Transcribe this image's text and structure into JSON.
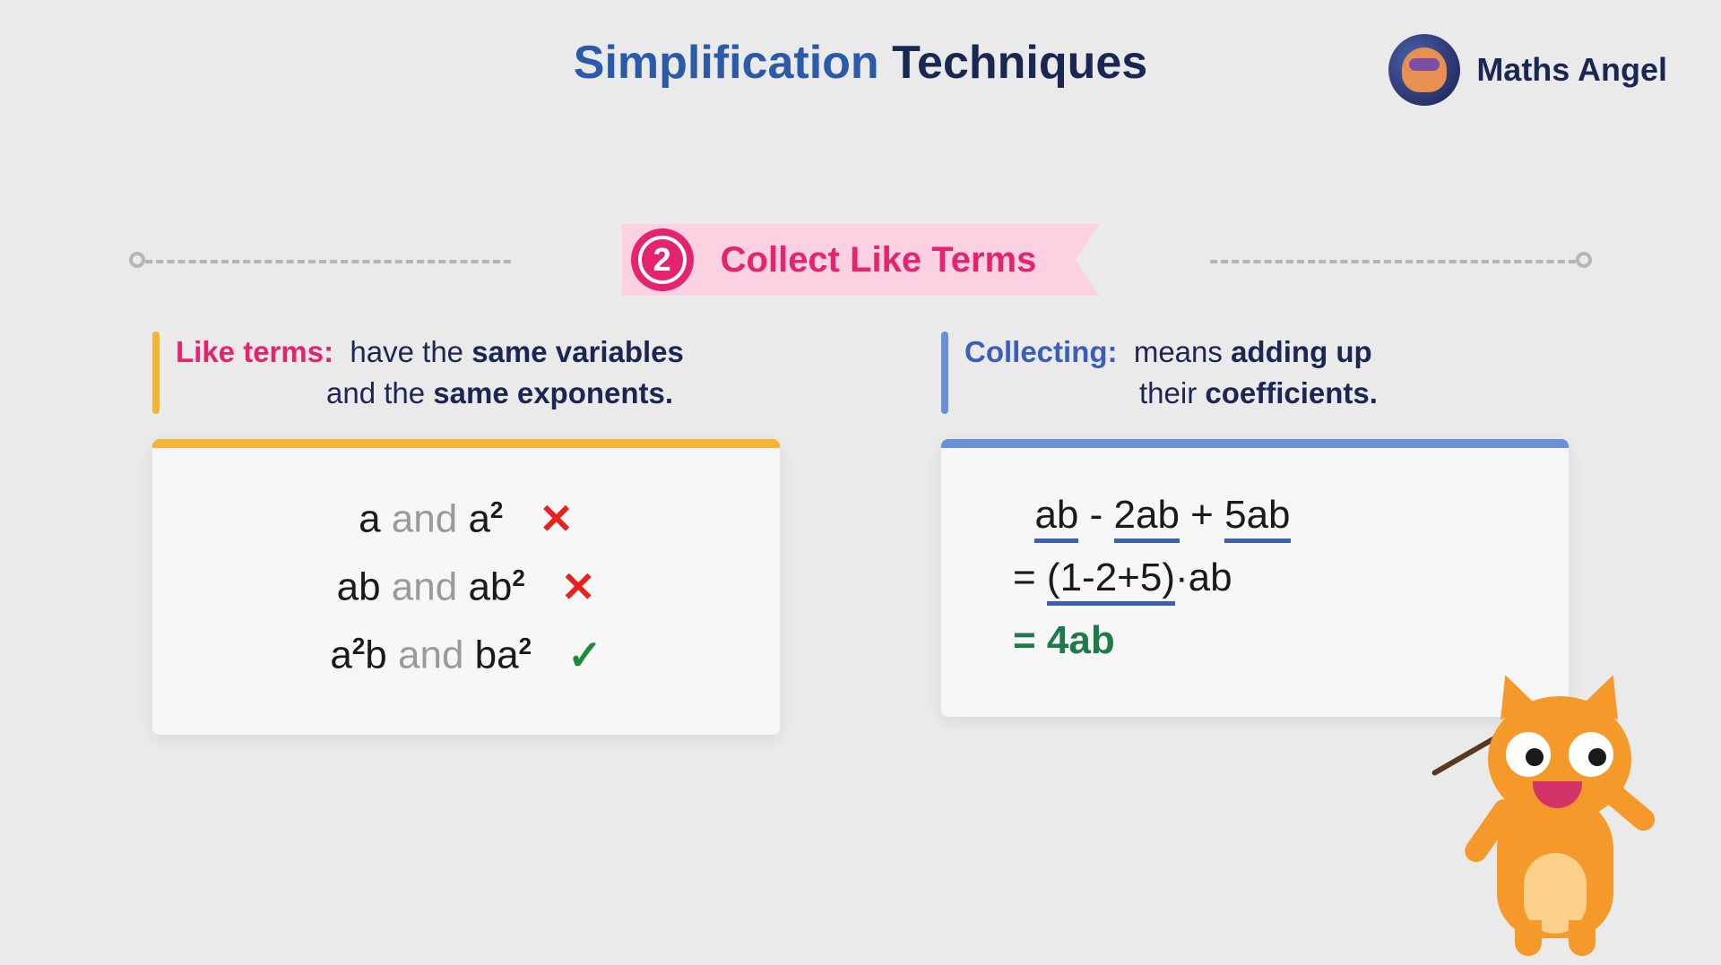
{
  "title": {
    "part1": "Simplification",
    "part2": "Techniques"
  },
  "brand": "Maths Angel",
  "step": {
    "number": "2",
    "label": "Collect Like Terms"
  },
  "left": {
    "label": "Like terms:",
    "text1": "have the",
    "bold1": "same variables",
    "text2": "and the",
    "bold2": "same exponents.",
    "examples": [
      {
        "t1": "a",
        "and": "and",
        "t2": "a",
        "sup": "2",
        "ok": false
      },
      {
        "t1": "ab",
        "and": "and",
        "t2": "ab",
        "sup": "2",
        "ok": false
      },
      {
        "t1pre": "a",
        "t1sup": "2",
        "t1post": "b",
        "and": "and",
        "t2": "ba",
        "sup": "2",
        "ok": true
      }
    ]
  },
  "right": {
    "label": "Collecting:",
    "text1": "means",
    "bold1": "adding up",
    "text2": "their",
    "bold2": "coefficients.",
    "eq1_parts": {
      "a": "ab",
      "b": "2ab",
      "c": "5ab",
      "minus": " - ",
      "plus": " + "
    },
    "eq2_parts": {
      "eq": "= ",
      "paren": "(1-2+5)",
      "tail": "·ab"
    },
    "eq3": "= 4ab"
  }
}
